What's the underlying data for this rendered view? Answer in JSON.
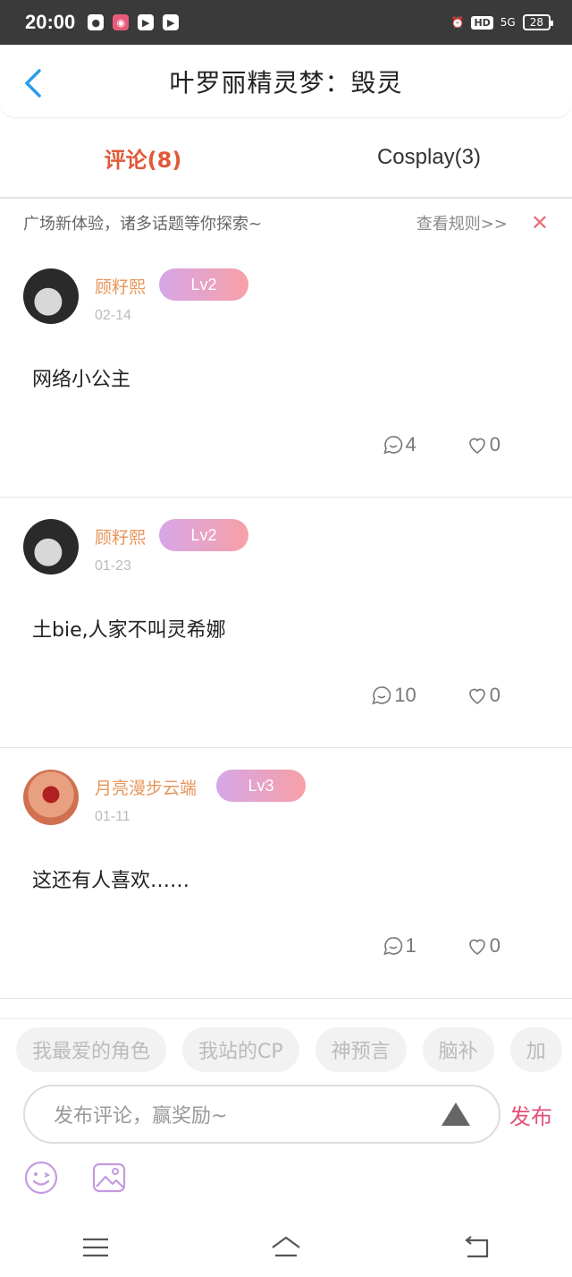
{
  "status_bar": {
    "time": "20:00",
    "battery": "28",
    "network": "5G",
    "hd": "HD"
  },
  "header": {
    "title": "叶罗丽精灵梦：毁灵",
    "back_icon": "chevron-left-icon"
  },
  "tabs": [
    {
      "label": "评论(8)",
      "active": true
    },
    {
      "label": "Cosplay(3)",
      "active": false
    }
  ],
  "notice": {
    "text": "广场新体验，诸多话题等你探索~",
    "rules": "查看规则>>",
    "close": "✕"
  },
  "comments": [
    {
      "username": "顾籽熙",
      "level": "Lv2",
      "date": "02-14",
      "text": "网络小公主",
      "replies": "4",
      "likes": "0"
    },
    {
      "username": "顾籽熙",
      "level": "Lv2",
      "date": "01-23",
      "text": "土bie,人家不叫灵希娜",
      "replies": "10",
      "likes": "0"
    },
    {
      "username": "月亮漫步云端",
      "level": "Lv3",
      "date": "01-11",
      "text": "这还有人喜欢……",
      "replies": "1",
      "likes": "0"
    }
  ],
  "topics": [
    "我最爱的角色",
    "我站的CP",
    "神预言",
    "脑补",
    "加"
  ],
  "input": {
    "placeholder": "发布评论，赢奖励~",
    "publish": "发布"
  },
  "colors": {
    "accent": "#e05a3a",
    "username": "#e8955a",
    "publish": "#e0507a",
    "back": "#2a9de8"
  }
}
